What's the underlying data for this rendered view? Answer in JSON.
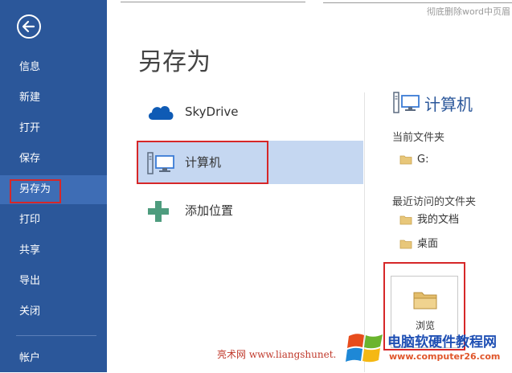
{
  "top_watermark": "彻底删除word中页眉",
  "sidebar": {
    "items": [
      {
        "label": "信息"
      },
      {
        "label": "新建"
      },
      {
        "label": "打开"
      },
      {
        "label": "保存"
      },
      {
        "label": "另存为"
      },
      {
        "label": "打印"
      },
      {
        "label": "共享"
      },
      {
        "label": "导出"
      },
      {
        "label": "关闭"
      },
      {
        "label": "帐户"
      }
    ],
    "active": "另存为",
    "colors": {
      "background": "#2b579a",
      "active": "#3e6db5"
    }
  },
  "main": {
    "title": "另存为",
    "places": [
      {
        "label": "SkyDrive",
        "icon": "cloud-icon"
      },
      {
        "label": "计算机",
        "icon": "computer-icon",
        "selected": true
      },
      {
        "label": "添加位置",
        "icon": "plus-icon"
      }
    ]
  },
  "right_panel": {
    "title": "计算机",
    "current_folder_label": "当前文件夹",
    "current_folders": [
      {
        "name": "G:"
      }
    ],
    "recent_label": "最近访问的文件夹",
    "recent_folders": [
      {
        "name": "我的文档"
      },
      {
        "name": "桌面"
      }
    ],
    "browse_label": "浏览"
  },
  "footer": {
    "url_text": "亮术网 www.liangshunet.",
    "logo_title": "电脑软硬件教程网",
    "logo_sub": "www.computer26.com"
  },
  "highlight_color": "#d62728"
}
